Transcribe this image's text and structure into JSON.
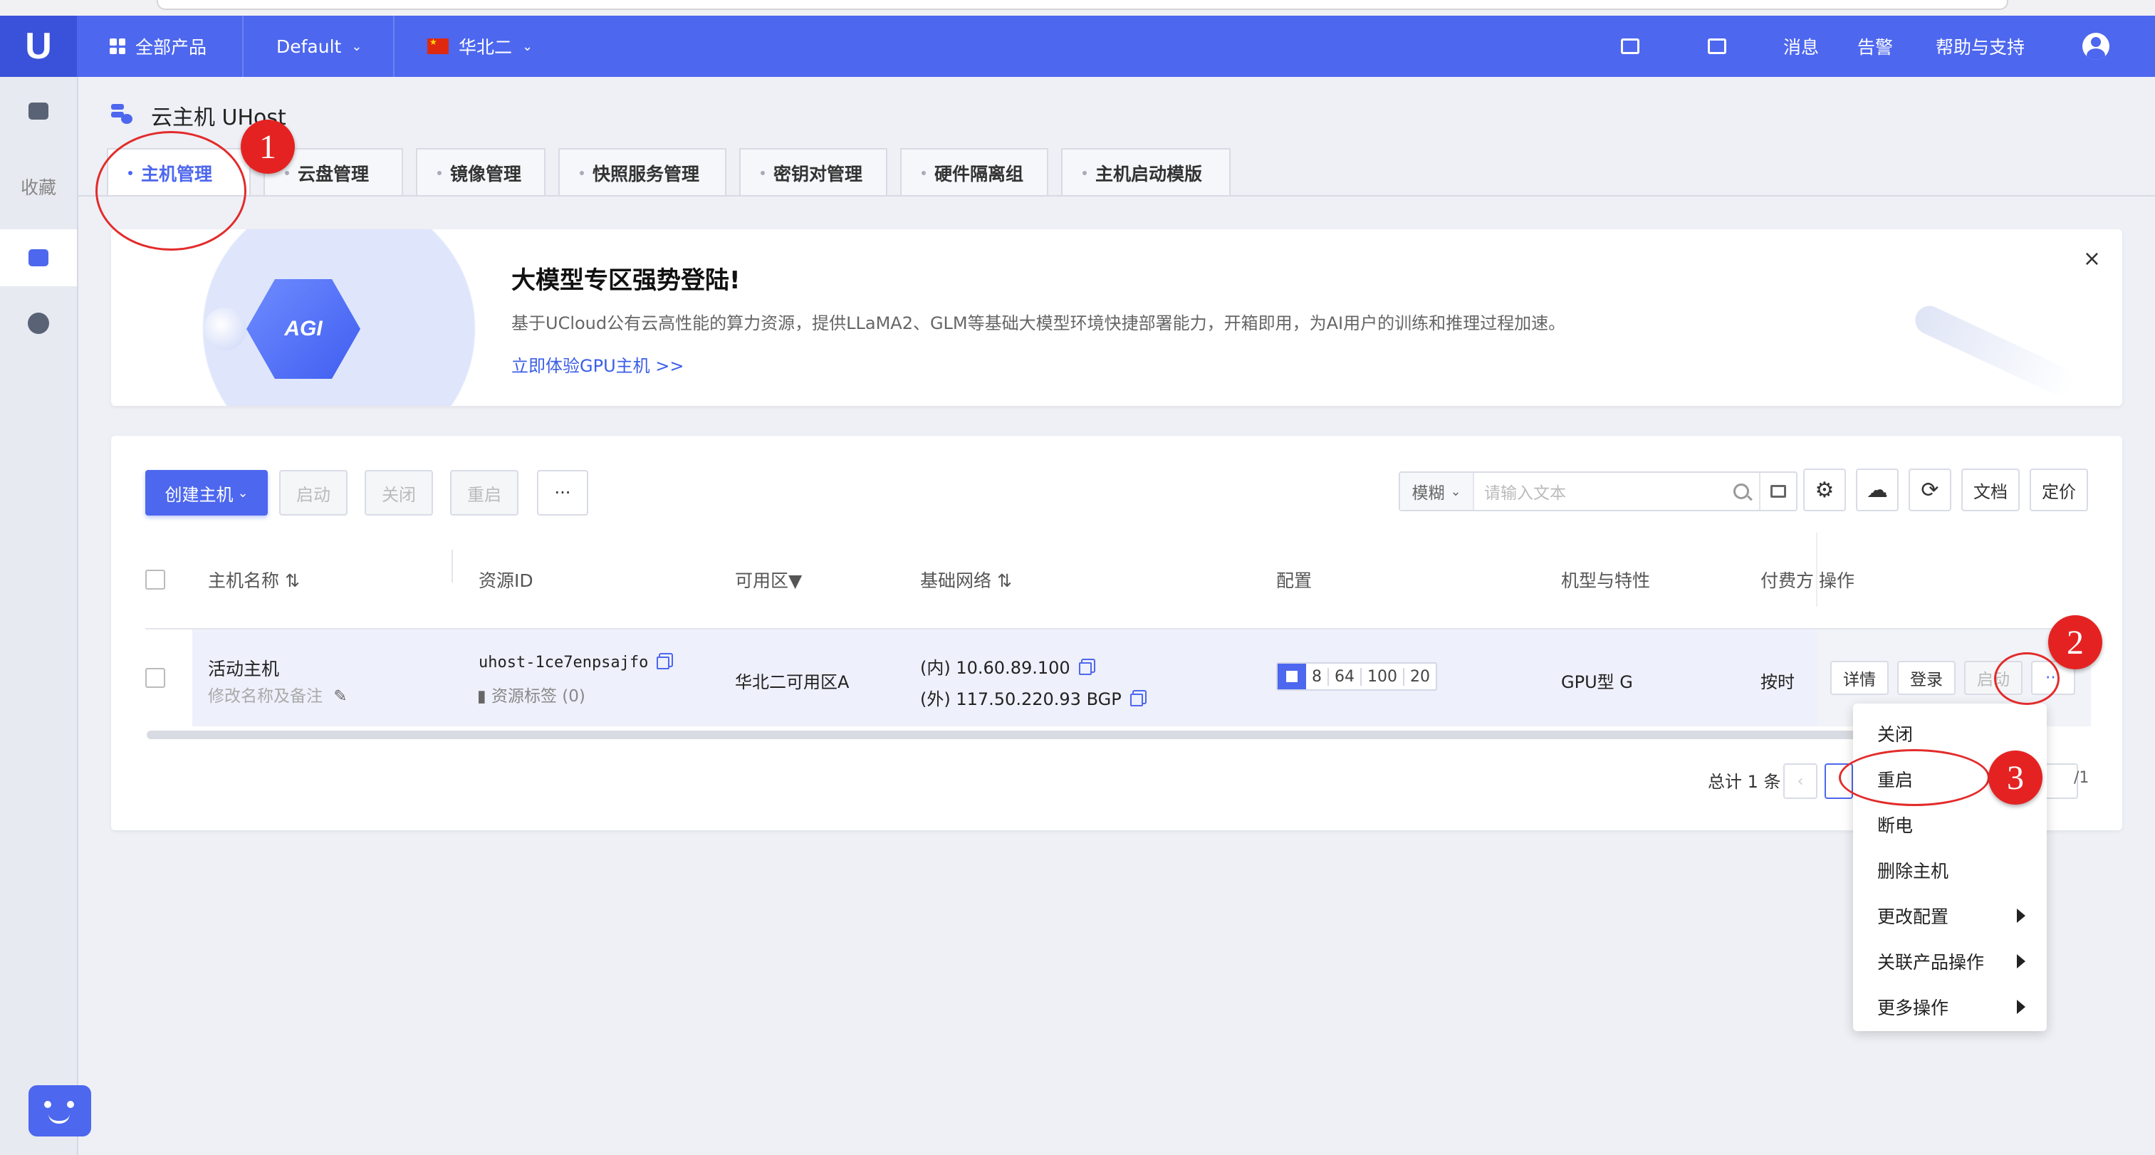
{
  "topbar": {
    "all_products": "全部产品",
    "project": "Default",
    "region": "华北二",
    "messages": "消息",
    "alerts": "告警",
    "help": "帮助与支持"
  },
  "sidebar": {
    "favorites": "收藏"
  },
  "page": {
    "title": "云主机 UHost"
  },
  "tabs": [
    "主机管理",
    "云盘管理",
    "镜像管理",
    "快照服务管理",
    "密钥对管理",
    "硬件隔离组",
    "主机启动模版"
  ],
  "banner": {
    "badge_text": "AGI",
    "title": "大模型专区强势登陆!",
    "description": "基于UCloud公有云高性能的算力资源，提供LLaMA2、GLM等基础大模型环境快捷部署能力，开箱即用，为AI用户的训练和推理过程加速。",
    "link": "立即体验GPU主机 >>",
    "close": "×"
  },
  "toolbar": {
    "create": "创建主机",
    "start": "启动",
    "stop": "关闭",
    "restart": "重启",
    "more": "···",
    "search_mode": "模糊",
    "search_placeholder": "请输入文本",
    "docs": "文档",
    "pricing": "定价"
  },
  "table": {
    "headers": {
      "name": "主机名称",
      "resource_id": "资源ID",
      "zone": "可用区",
      "network": "基础网络",
      "config": "配置",
      "model": "机型与特性",
      "billing": "付费方",
      "actions": "操作"
    },
    "row": {
      "name": "活动主机",
      "name_hint": "修改名称及备注",
      "resource_id": "uhost-1ce7enpsajfo",
      "tags": "资源标签 (0)",
      "zone": "华北二可用区A",
      "ip_internal": "(内) 10.60.89.100",
      "ip_external": "(外) 117.50.220.93 BGP",
      "config": [
        "8",
        "64",
        "100",
        "20"
      ],
      "model": "GPU型 G",
      "billing": "按时",
      "btn_detail": "详情",
      "btn_login": "登录",
      "btn_start": "启动",
      "btn_more": "···"
    }
  },
  "pager": {
    "total": "总计 1 条",
    "pages": "/1"
  },
  "menu": {
    "items": [
      "关闭",
      "重启",
      "断电",
      "删除主机",
      "更改配置",
      "关联产品操作",
      "更多操作"
    ]
  },
  "annotations": {
    "one": "1",
    "two": "2",
    "three": "3",
    "color": "#e32b2b"
  }
}
